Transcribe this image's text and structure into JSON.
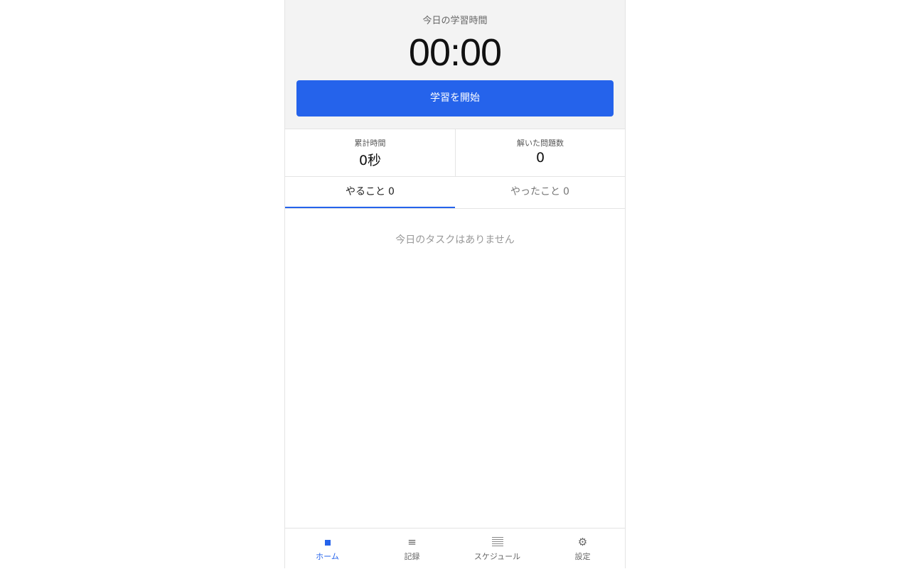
{
  "timer": {
    "label": "今日の学習時間",
    "value": "00:00",
    "start_label": "学習を開始"
  },
  "stats": {
    "total_time_label": "累計時間",
    "total_time_value": "0秒",
    "solved_label": "解いた問題数",
    "solved_value": "0"
  },
  "tabs": [
    {
      "label": "やること",
      "count": "0",
      "active": true
    },
    {
      "label": "やったこと",
      "count": "0",
      "active": false
    }
  ],
  "empty_message": "今日のタスクはありません",
  "nav": {
    "items": [
      {
        "label": "ホーム",
        "icon": "home-square-icon",
        "active": true
      },
      {
        "label": "記録",
        "icon": "list-icon",
        "glyph": "≡"
      },
      {
        "label": "スケジュール",
        "icon": "calendar-lines-icon"
      },
      {
        "label": "設定",
        "icon": "gear-icon",
        "glyph": "⚙"
      }
    ]
  },
  "colors": {
    "accent": "#2563eb",
    "panel_bg": "#f3f3f3"
  }
}
